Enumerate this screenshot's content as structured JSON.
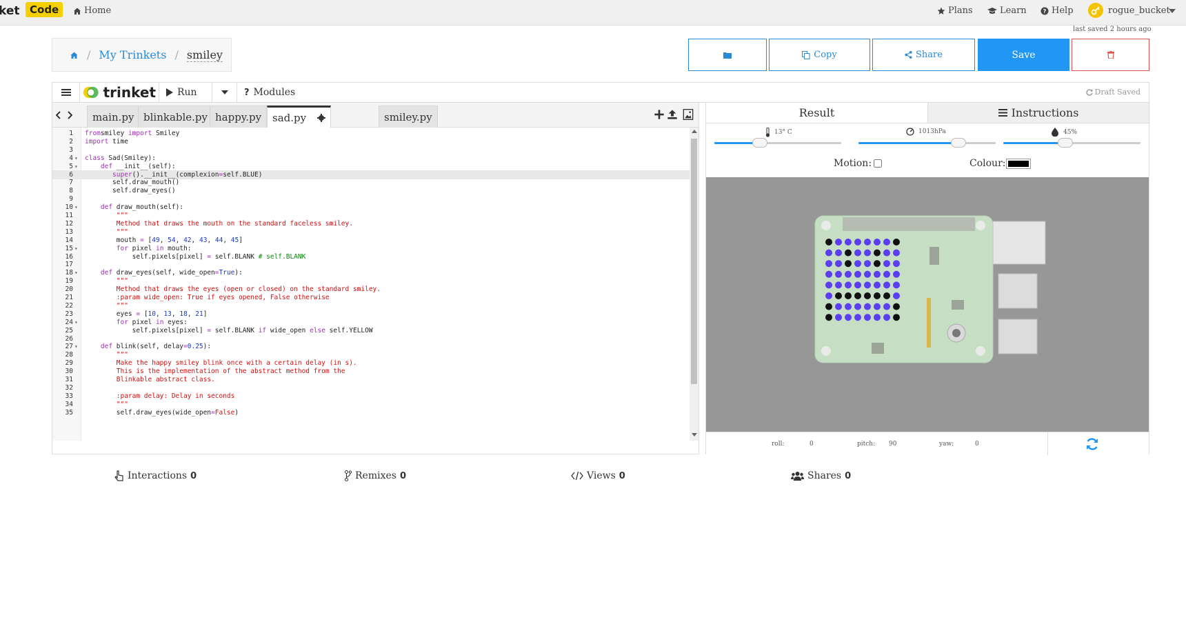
{
  "nav": {
    "brand_text": "ket",
    "brand_badge": "Code",
    "home": "Home",
    "plans": "Plans",
    "learn": "Learn",
    "help": "Help",
    "username": "rogue_bucket"
  },
  "status": {
    "last_saved": "last saved 2 hours ago"
  },
  "breadcrumb": {
    "my_trinkets": "My Trinkets",
    "separator": "/",
    "title": "smiley"
  },
  "actions": {
    "copy": "Copy",
    "share": "Share",
    "save": "Save"
  },
  "toolbar": {
    "logo": "trinket",
    "run": "Run",
    "modules": "Modules",
    "draft": "Draft Saved"
  },
  "tabs": [
    "main.py",
    "blinkable.py",
    "happy.py",
    "sad.py",
    "smiley.py"
  ],
  "active_tab": "sad.py",
  "code": [
    {
      "n": "1",
      "f": "",
      "t": [
        [
          "kw",
          "from"
        ],
        [
          "",
          "smiley "
        ],
        [
          "kw",
          "import"
        ],
        [
          "",
          " Smiley"
        ]
      ]
    },
    {
      "n": "2",
      "f": "",
      "t": [
        [
          "kw",
          "import"
        ],
        [
          "",
          " time"
        ]
      ]
    },
    {
      "n": "3",
      "f": "",
      "t": []
    },
    {
      "n": "4",
      "f": "▾",
      "t": [
        [
          "kw",
          "class"
        ],
        [
          "",
          " Sad(Smiley):"
        ]
      ]
    },
    {
      "n": "5",
      "f": "▾",
      "t": [
        [
          "",
          "    "
        ],
        [
          "kw",
          "def"
        ],
        [
          "",
          " __init__(self):"
        ]
      ]
    },
    {
      "n": "6",
      "f": "",
      "t": [
        [
          "",
          "       "
        ],
        [
          "kw",
          "super"
        ],
        [
          "",
          "().__init__(complexion"
        ],
        [
          "kw",
          "="
        ],
        [
          "",
          "self.BLUE)"
        ]
      ]
    },
    {
      "n": "7",
      "f": "",
      "t": [
        [
          "",
          "       self.draw_mouth()"
        ]
      ]
    },
    {
      "n": "8",
      "f": "",
      "t": [
        [
          "",
          "       self.draw_eyes()"
        ]
      ]
    },
    {
      "n": "9",
      "f": "",
      "t": []
    },
    {
      "n": "10",
      "f": "▾",
      "t": [
        [
          "",
          "    "
        ],
        [
          "kw",
          "def"
        ],
        [
          "",
          " draw_mouth(self):"
        ]
      ]
    },
    {
      "n": "11",
      "f": "",
      "t": [
        [
          "",
          "        "
        ],
        [
          "str",
          "\"\"\""
        ]
      ]
    },
    {
      "n": "12",
      "f": "",
      "t": [
        [
          "",
          "        "
        ],
        [
          "str",
          "Method that draws the mouth on the standard faceless smiley."
        ]
      ]
    },
    {
      "n": "13",
      "f": "",
      "t": [
        [
          "",
          "        "
        ],
        [
          "str",
          "\"\"\""
        ]
      ]
    },
    {
      "n": "14",
      "f": "",
      "t": [
        [
          "",
          "        mouth "
        ],
        [
          "kw",
          "="
        ],
        [
          "",
          " ["
        ],
        [
          "num-lit",
          "49"
        ],
        [
          "",
          ", "
        ],
        [
          "num-lit",
          "54"
        ],
        [
          "",
          ", "
        ],
        [
          "num-lit",
          "42"
        ],
        [
          "",
          ", "
        ],
        [
          "num-lit",
          "43"
        ],
        [
          "",
          ", "
        ],
        [
          "num-lit",
          "44"
        ],
        [
          "",
          ", "
        ],
        [
          "num-lit",
          "45"
        ],
        [
          "",
          "]"
        ]
      ]
    },
    {
      "n": "15",
      "f": "▾",
      "t": [
        [
          "",
          "        "
        ],
        [
          "kw",
          "for"
        ],
        [
          "",
          " pixel "
        ],
        [
          "kw",
          "in"
        ],
        [
          "",
          " mouth:"
        ]
      ]
    },
    {
      "n": "16",
      "f": "",
      "t": [
        [
          "",
          "            self.pixels[pixel] "
        ],
        [
          "kw",
          "="
        ],
        [
          "",
          " self.BLANK "
        ],
        [
          "cm",
          "# self.BLANK"
        ]
      ]
    },
    {
      "n": "17",
      "f": "",
      "t": []
    },
    {
      "n": "18",
      "f": "▾",
      "t": [
        [
          "",
          "    "
        ],
        [
          "kw",
          "def"
        ],
        [
          "",
          " draw_eyes(self, wide_open"
        ],
        [
          "kw",
          "="
        ],
        [
          "num-lit",
          "True"
        ],
        [
          "",
          "):"
        ]
      ]
    },
    {
      "n": "19",
      "f": "",
      "t": [
        [
          "",
          "        "
        ],
        [
          "str",
          "\"\"\""
        ]
      ]
    },
    {
      "n": "20",
      "f": "",
      "t": [
        [
          "",
          "        "
        ],
        [
          "str",
          "Method that draws the eyes (open or closed) on the standard smiley."
        ]
      ]
    },
    {
      "n": "21",
      "f": "",
      "t": [
        [
          "",
          "        "
        ],
        [
          "str",
          ":param wide_open: True if eyes opened, False otherwise"
        ]
      ]
    },
    {
      "n": "22",
      "f": "",
      "t": [
        [
          "",
          "        "
        ],
        [
          "str",
          "\"\"\""
        ]
      ]
    },
    {
      "n": "23",
      "f": "",
      "t": [
        [
          "",
          "        eyes "
        ],
        [
          "kw",
          "="
        ],
        [
          "",
          " ["
        ],
        [
          "num-lit",
          "10"
        ],
        [
          "",
          ", "
        ],
        [
          "num-lit",
          "13"
        ],
        [
          "",
          ", "
        ],
        [
          "num-lit",
          "18"
        ],
        [
          "",
          ", "
        ],
        [
          "num-lit",
          "21"
        ],
        [
          "",
          "]"
        ]
      ]
    },
    {
      "n": "24",
      "f": "▾",
      "t": [
        [
          "",
          "        "
        ],
        [
          "kw",
          "for"
        ],
        [
          "",
          " pixel "
        ],
        [
          "kw",
          "in"
        ],
        [
          "",
          " eyes:"
        ]
      ]
    },
    {
      "n": "25",
      "f": "",
      "t": [
        [
          "",
          "            self.pixels[pixel] "
        ],
        [
          "kw",
          "="
        ],
        [
          "",
          " self.BLANK "
        ],
        [
          "kw",
          "if"
        ],
        [
          "",
          " wide_open "
        ],
        [
          "kw",
          "else"
        ],
        [
          "",
          " self.YELLOW"
        ]
      ]
    },
    {
      "n": "26",
      "f": "",
      "t": []
    },
    {
      "n": "27",
      "f": "▾",
      "t": [
        [
          "",
          "    "
        ],
        [
          "kw",
          "def"
        ],
        [
          "",
          " blink(self, delay"
        ],
        [
          "kw",
          "="
        ],
        [
          "num-lit",
          "0.25"
        ],
        [
          "",
          "):"
        ]
      ]
    },
    {
      "n": "28",
      "f": "",
      "t": [
        [
          "",
          "        "
        ],
        [
          "str",
          "\"\"\""
        ]
      ]
    },
    {
      "n": "29",
      "f": "",
      "t": [
        [
          "",
          "        "
        ],
        [
          "str",
          "Make the happy smiley blink once with a certain delay (in s)."
        ]
      ]
    },
    {
      "n": "30",
      "f": "",
      "t": [
        [
          "",
          "        "
        ],
        [
          "str",
          "This is the implementation of the abstract method from the"
        ]
      ]
    },
    {
      "n": "31",
      "f": "",
      "t": [
        [
          "",
          "        "
        ],
        [
          "str",
          "Blinkable abstract class."
        ]
      ]
    },
    {
      "n": "32",
      "f": "",
      "t": []
    },
    {
      "n": "33",
      "f": "",
      "t": [
        [
          "",
          "        "
        ],
        [
          "str",
          ":param delay: Delay in seconds"
        ]
      ]
    },
    {
      "n": "34",
      "f": "",
      "t": [
        [
          "",
          "        "
        ],
        [
          "str",
          "\"\"\""
        ]
      ]
    },
    {
      "n": "35",
      "f": "",
      "t": [
        [
          "",
          "        self.draw_eyes(wide_open"
        ],
        [
          "kw",
          "="
        ],
        [
          "str",
          "False"
        ],
        [
          "",
          ")"
        ]
      ]
    }
  ],
  "highlighted_line": "6",
  "result_tabs": {
    "result": "Result",
    "instructions": "Instructions"
  },
  "sensors": {
    "temperature": {
      "label": "13° C",
      "fraction": 0.36
    },
    "pressure": {
      "label": "1013hPa",
      "fraction": 0.73
    },
    "humidity": {
      "label": "45%",
      "fraction": 0.45
    }
  },
  "controls": {
    "motion_label": "Motion:",
    "colour_label": "Colour:",
    "colour_value": "#000000"
  },
  "led_matrix": [
    "kbbbbbbk",
    "bbkbbkbb",
    "bbkbbkbb",
    "bbbbbbbb",
    "bbbbbbbb",
    "bkkkkkkb",
    "kbbbbbbk",
    "kbbbbbbk"
  ],
  "led_colors": {
    "b": "#5b3df2",
    "k": "#111111"
  },
  "orientation": {
    "roll_label": "roll:",
    "roll": "0",
    "pitch_label": "pitch:",
    "pitch": "90",
    "yaw_label": "yaw:",
    "yaw": "0"
  },
  "stats": {
    "interactions": "Interactions",
    "interactions_count": "0",
    "remixes": "Remixes",
    "remixes_count": "0",
    "views": "Views",
    "views_count": "0",
    "shares": "Shares",
    "shares_count": "0"
  }
}
